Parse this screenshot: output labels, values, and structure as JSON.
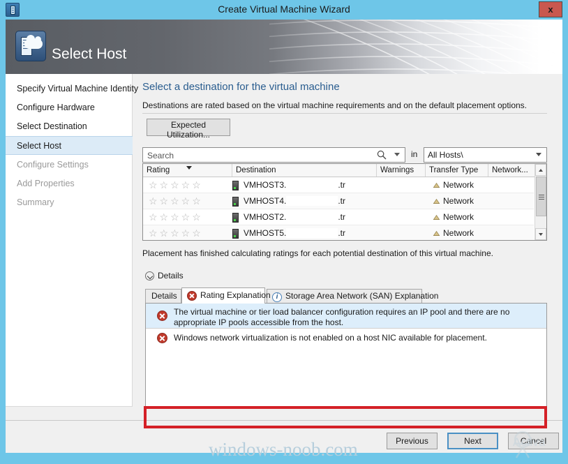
{
  "window": {
    "title": "Create Virtual Machine Wizard",
    "app_icon": "wizard-icon",
    "close_label": "x"
  },
  "banner": {
    "title": "Select Host",
    "icon": "host-cloud-icon"
  },
  "sidebar": {
    "items": [
      {
        "label": "Specify Virtual Machine Identity",
        "state": "done"
      },
      {
        "label": "Configure Hardware",
        "state": "done"
      },
      {
        "label": "Select Destination",
        "state": "done"
      },
      {
        "label": "Select Host",
        "state": "selected"
      },
      {
        "label": "Configure Settings",
        "state": "disabled"
      },
      {
        "label": "Add Properties",
        "state": "disabled"
      },
      {
        "label": "Summary",
        "state": "disabled"
      }
    ]
  },
  "main": {
    "heading": "Select a destination for the virtual machine",
    "subtext": "Destinations are rated based on the virtual machine requirements and on the default placement options.",
    "utilization_button": "Expected Utilization...",
    "search": {
      "placeholder": "Search",
      "value": "",
      "icon": "search-icon",
      "caret": "chevron-down-icon"
    },
    "scope": {
      "in_label": "in",
      "value": "All Hosts\\",
      "caret": "chevron-down-icon"
    },
    "status_line": "Placement has finished calculating ratings for each potential destination of this virtual machine.",
    "details_expander": "Details"
  },
  "table": {
    "columns": [
      "Rating",
      "Destination",
      "Warnings",
      "Transfer Type",
      "Network..."
    ],
    "sorted_column": "Rating",
    "rows": [
      {
        "rating": 0,
        "stars": "☆☆☆☆☆",
        "name": "VMHOST3.",
        "suffix": ".tr",
        "warnings": "",
        "transfer_type": "Network",
        "network": ""
      },
      {
        "rating": 0,
        "stars": "☆☆☆☆☆",
        "name": "VMHOST4.",
        "suffix": ".tr",
        "warnings": "",
        "transfer_type": "Network",
        "network": ""
      },
      {
        "rating": 0,
        "stars": "☆☆☆☆☆",
        "name": "VMHOST2.",
        "suffix": ".tr",
        "warnings": "",
        "transfer_type": "Network",
        "network": ""
      },
      {
        "rating": 0,
        "stars": "☆☆☆☆☆",
        "name": "VMHOST5.",
        "suffix": ".tr",
        "warnings": "",
        "transfer_type": "Network",
        "network": ""
      }
    ]
  },
  "tabs": [
    {
      "label": "Details",
      "icon": "none",
      "active": false
    },
    {
      "label": "Rating Explanation",
      "icon": "error-icon",
      "active": true
    },
    {
      "label": "Storage Area Network (SAN) Explanation",
      "icon": "info-icon",
      "active": false
    }
  ],
  "messages": [
    {
      "icon": "error-icon",
      "text": "The virtual machine or tier load balancer configuration requires an IP pool and there are no appropriate IP pools accessible from the host.",
      "selected": true,
      "highlighted": false
    },
    {
      "icon": "error-icon",
      "text": "Windows network virtualization is not enabled on a host NIC available for placement.",
      "selected": false,
      "highlighted": true
    }
  ],
  "footer": {
    "previous": "Previous",
    "next": "Next",
    "cancel": "Cancel"
  },
  "watermarks": {
    "site": "windows-noob.com",
    "activate": "Activa"
  },
  "colors": {
    "accent": "#6ec6e8",
    "heading": "#2a5d8f",
    "selection": "#dcebf7",
    "error": "#c0392b",
    "highlight": "#d42027",
    "close": "#c9584f"
  }
}
